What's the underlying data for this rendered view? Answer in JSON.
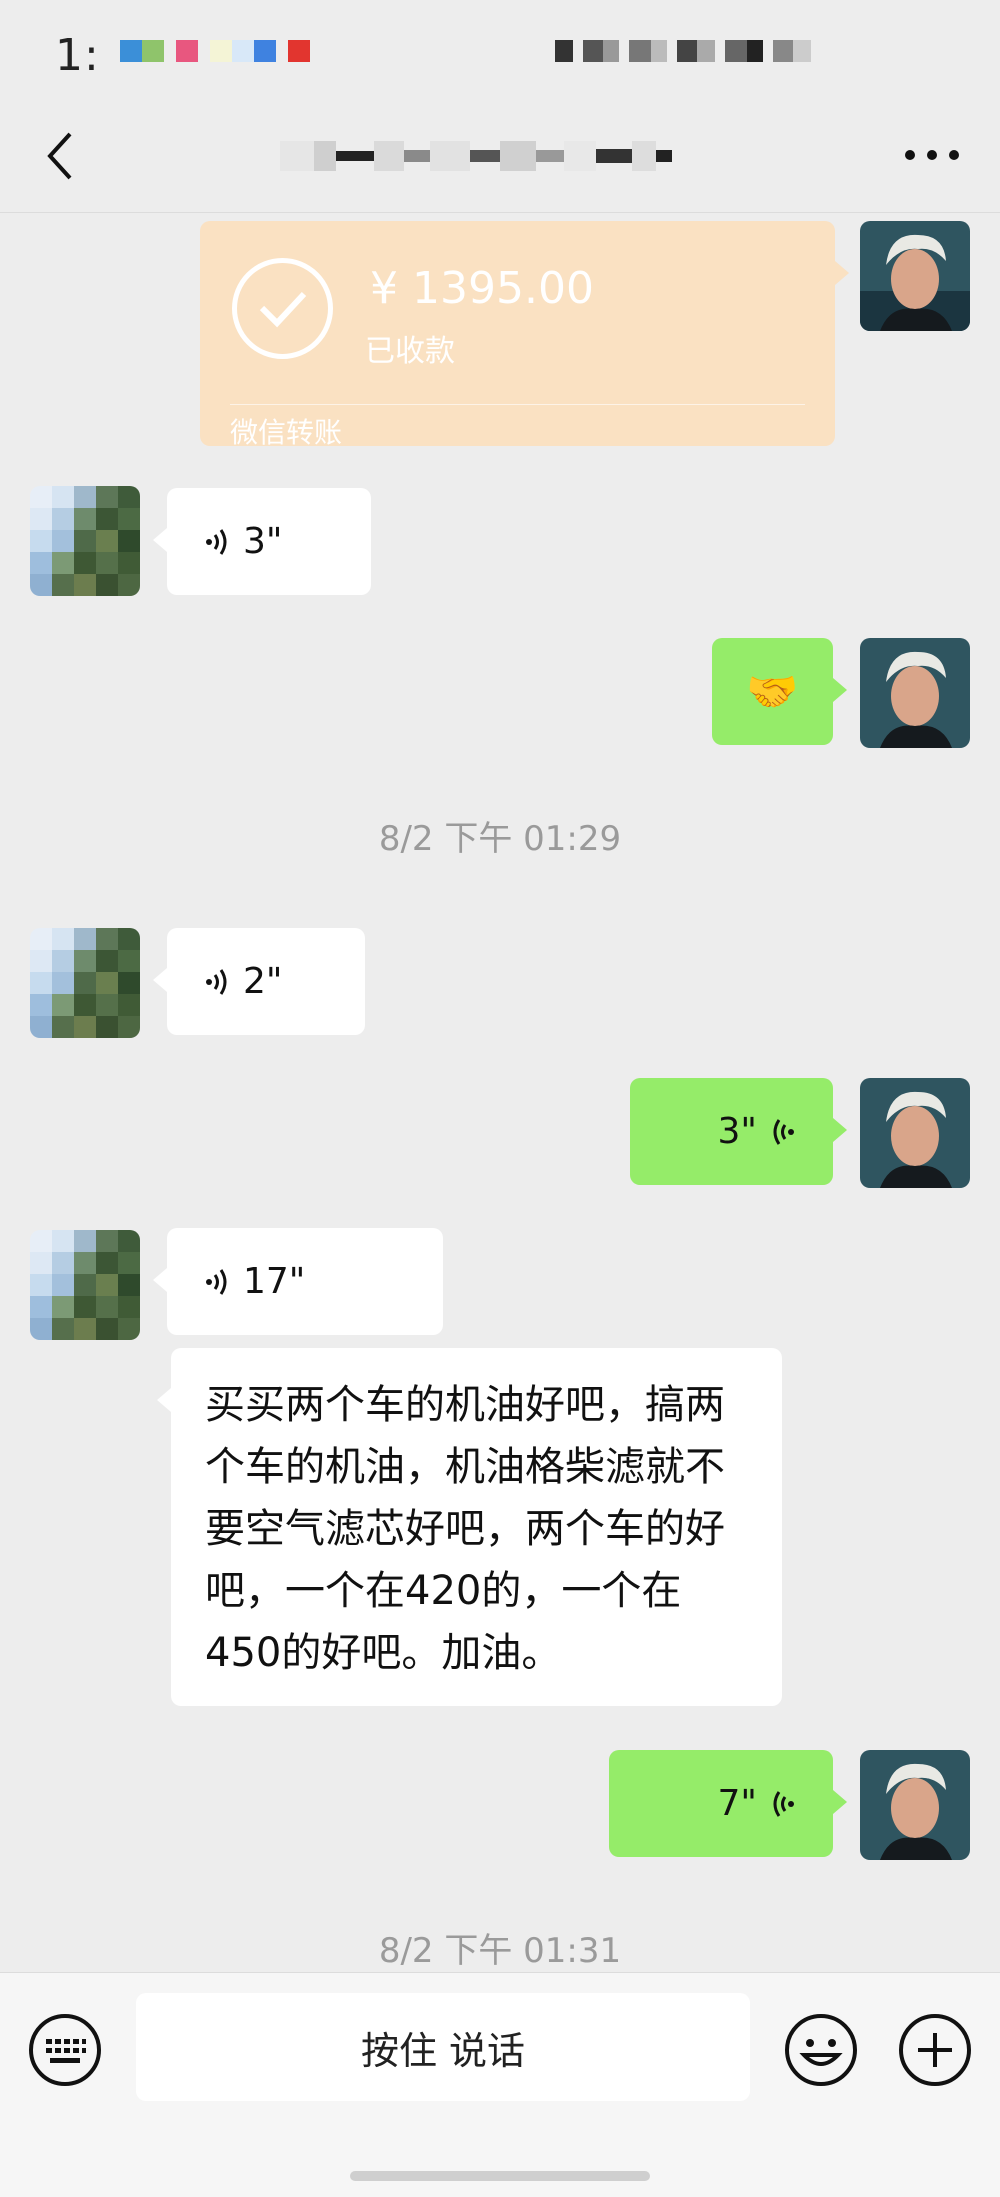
{
  "status_bar": {
    "time": "1:"
  },
  "nav": {
    "title": ""
  },
  "transfer": {
    "amount": "¥ 1395.00",
    "status": "已收款",
    "label": "微信转账"
  },
  "messages": {
    "m1_voice": "3\"",
    "m2_emoji": "🤝",
    "ts1": "8/2 下午 01:29",
    "m3_voice": "2\"",
    "m4_voice": "3\"",
    "m5_voice": "17\"",
    "m6_text": "买买两个车的机油好吧，搞两个车的机油，机油格柴滤就不要空气滤芯好吧，两个车的好吧，一个在420的，一个在450的好吧。加油。",
    "m7_voice": "7\"",
    "ts2": "8/2 下午 01:31"
  },
  "input_bar": {
    "hold_to_talk": "按住 说话"
  },
  "colors": {
    "bubble_green": "#95ec69",
    "transfer_orange": "#fae1c2",
    "background": "#ededed"
  },
  "icons": [
    "back-icon",
    "more-icon",
    "check-icon",
    "voice-icon",
    "keyboard-icon",
    "emoji-icon",
    "plus-icon"
  ]
}
